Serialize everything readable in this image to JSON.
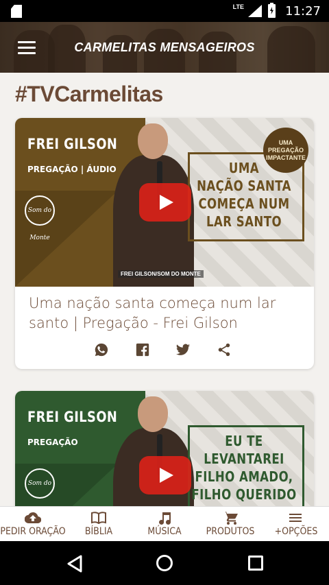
{
  "status_bar": {
    "time": "11:27",
    "network": "LTE"
  },
  "header": {
    "title": "CARMELITAS MENSAGEIROS"
  },
  "section": {
    "title": "#TVCarmelitas"
  },
  "videos": [
    {
      "speaker": "FREI GILSON",
      "subtitle": "PREGAÇÃO | ÁUDIO",
      "headline": [
        "UMA",
        "NAÇÃO SANTA",
        "COMEÇA NUM",
        "LAR SANTO"
      ],
      "badge": [
        "UMA",
        "PREGAÇÃO",
        "IMPACTANTE"
      ],
      "logo": "Som do Monte",
      "credit": "FREI GILSON/SOM DO MONTE",
      "title": "Uma nação santa começa num lar santo | Pregação - Frei Gilson",
      "theme_color": "#6b4f1e"
    },
    {
      "speaker": "FREI GILSON",
      "subtitle": "PREGAÇÃO",
      "headline": [
        "EU TE",
        "LEVANTAREI",
        "FILHO AMADO,",
        "FILHO QUERIDO"
      ],
      "logo": "Som do Monte",
      "theme_color": "#2f5a2f"
    }
  ],
  "bottom_nav": [
    {
      "label": "PEDIR ORAÇÃO",
      "icon": "cloud-upload-icon"
    },
    {
      "label": "BÍBLIA",
      "icon": "book-icon"
    },
    {
      "label": "MÚSICA",
      "icon": "music-note-icon"
    },
    {
      "label": "PRODUTOS",
      "icon": "cart-icon"
    },
    {
      "label": "+OPÇÕES",
      "icon": "menu-icon"
    }
  ],
  "colors": {
    "brand_brown": "#6b4a36",
    "card_bg": "#ffffff",
    "page_bg": "#f3f1ee",
    "play_red": "#e62117"
  }
}
